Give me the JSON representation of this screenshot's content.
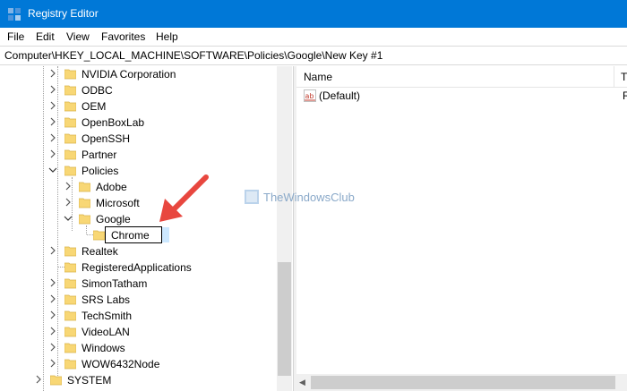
{
  "window": {
    "title": "Registry Editor"
  },
  "menu": [
    "File",
    "Edit",
    "View",
    "Favorites",
    "Help"
  ],
  "address": "Computer\\HKEY_LOCAL_MACHINE\\SOFTWARE\\Policies\\Google\\New Key #1",
  "tree": {
    "items": [
      {
        "label": "NVIDIA Corporation",
        "expanded": false
      },
      {
        "label": "ODBC",
        "expanded": false
      },
      {
        "label": "OEM",
        "expanded": false
      },
      {
        "label": "OpenBoxLab",
        "expanded": false
      },
      {
        "label": "OpenSSH",
        "expanded": false
      },
      {
        "label": "Partner",
        "expanded": false
      },
      {
        "label": "Policies",
        "expanded": true
      },
      {
        "label": "Adobe",
        "expanded": false
      },
      {
        "label": "Microsoft",
        "expanded": false
      },
      {
        "label": "Google",
        "expanded": true
      },
      {
        "label": "Chrome",
        "editing": true
      },
      {
        "label": "Realtek",
        "expanded": false
      },
      {
        "label": "RegisteredApplications"
      },
      {
        "label": "SimonTatham",
        "expanded": false
      },
      {
        "label": "SRS Labs",
        "expanded": false
      },
      {
        "label": "TechSmith",
        "expanded": false
      },
      {
        "label": "VideoLAN",
        "expanded": false
      },
      {
        "label": "Windows",
        "expanded": false
      },
      {
        "label": "WOW6432Node",
        "expanded": false
      },
      {
        "label": "SYSTEM",
        "expanded": false
      }
    ]
  },
  "list": {
    "columns": {
      "name": "Name",
      "type": "T"
    },
    "rows": [
      {
        "name": "(Default)",
        "type": "R",
        "icon": "string-value-icon"
      }
    ]
  },
  "watermark": "TheWindowsClub",
  "colors": {
    "titlebar": "#0078d7",
    "folder": "#f8d775",
    "arrow": "#e8473f",
    "selection": "#cce8ff"
  }
}
